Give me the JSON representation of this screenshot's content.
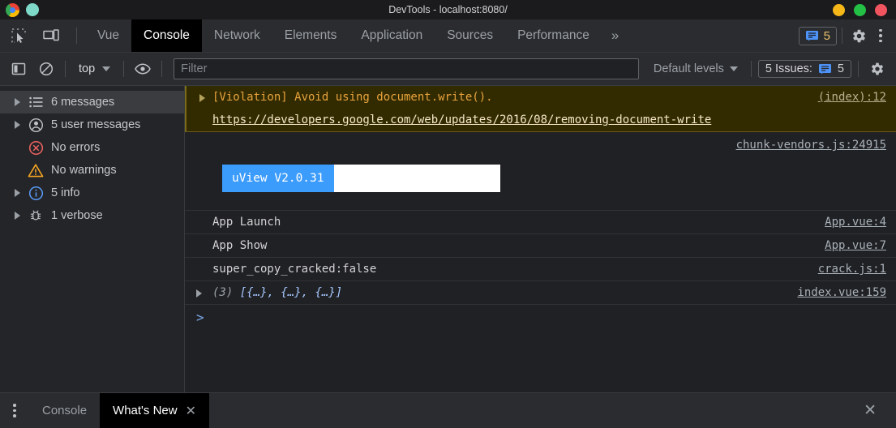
{
  "window": {
    "title": "DevTools - localhost:8080/",
    "controls": [
      "minimize",
      "maximize",
      "close"
    ]
  },
  "tabbar": {
    "inspect_icon": "inspect-element-icon",
    "device_icon": "device-toolbar-icon",
    "tabs": [
      {
        "label": "Vue",
        "active": false
      },
      {
        "label": "Console",
        "active": true
      },
      {
        "label": "Network",
        "active": false
      },
      {
        "label": "Elements",
        "active": false
      },
      {
        "label": "Application",
        "active": false
      },
      {
        "label": "Sources",
        "active": false
      },
      {
        "label": "Performance",
        "active": false
      }
    ],
    "more_label": "»",
    "issue_chip": {
      "icon": "message-bubble-icon",
      "count": "5"
    },
    "settings_icon": "gear-icon",
    "menu_icon": "kebab-menu-icon"
  },
  "console_toolbar": {
    "sidebar_toggle_icon": "sidebar-toggle-icon",
    "clear_icon": "clear-console-icon",
    "context": "top",
    "eye_icon": "live-expression-icon",
    "filter_placeholder": "Filter",
    "filter_value": "",
    "levels_label": "Default levels",
    "issues_label": "5 Issues:",
    "issues_count": "5",
    "settings_icon": "gear-icon"
  },
  "sidebar": {
    "items": [
      {
        "label": "6 messages",
        "icon": "list-icon",
        "expandable": true,
        "selected": true
      },
      {
        "label": "5 user messages",
        "icon": "user-icon",
        "expandable": true,
        "selected": false
      },
      {
        "label": "No errors",
        "icon": "error-icon",
        "expandable": false,
        "selected": false
      },
      {
        "label": "No warnings",
        "icon": "warning-icon",
        "expandable": false,
        "selected": false
      },
      {
        "label": "5 info",
        "icon": "info-icon",
        "expandable": true,
        "selected": false
      },
      {
        "label": "1 verbose",
        "icon": "bug-icon",
        "expandable": true,
        "selected": false
      }
    ]
  },
  "console": {
    "violation": {
      "text": "[Violation] Avoid using document.write().",
      "link": "https://developers.google.com/web/updates/2016/08/removing-document-write",
      "source": "(index):12"
    },
    "banner": {
      "source": "chunk-vendors.js:24915",
      "badge_label": "uView V2.0.31",
      "badge_color": "#3c9cfc"
    },
    "rows": [
      {
        "text": "App Launch",
        "source": "App.vue:4"
      },
      {
        "text": "App Show",
        "source": "App.vue:7"
      },
      {
        "text": "super_copy_cracked:false",
        "source": "crack.js:1"
      }
    ],
    "array_row": {
      "count": "(3)",
      "preview": "[{…}, {…}, {…}]",
      "source": "index.vue:159"
    },
    "prompt_symbol": ">"
  },
  "drawer": {
    "menu_icon": "kebab-menu-icon",
    "tabs": [
      {
        "label": "Console",
        "active": false,
        "closable": false
      },
      {
        "label": "What's New",
        "active": true,
        "closable": true
      }
    ],
    "close_label": "✕",
    "close_drawer_icon": "close-icon"
  }
}
